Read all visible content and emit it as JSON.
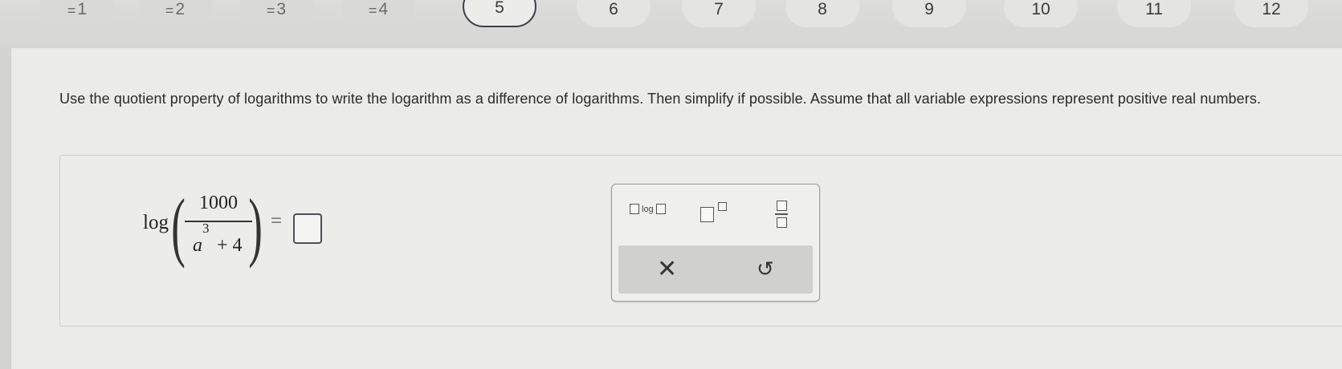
{
  "nav": {
    "items": [
      {
        "label": "1",
        "state": "done"
      },
      {
        "label": "2",
        "state": "done"
      },
      {
        "label": "3",
        "state": "done"
      },
      {
        "label": "4",
        "state": "done"
      },
      {
        "label": "5",
        "state": "current"
      },
      {
        "label": "6",
        "state": "todo"
      },
      {
        "label": "7",
        "state": "todo"
      },
      {
        "label": "8",
        "state": "todo"
      },
      {
        "label": "9",
        "state": "todo"
      },
      {
        "label": "10",
        "state": "todo"
      },
      {
        "label": "11",
        "state": "todo"
      },
      {
        "label": "12",
        "state": "todo"
      }
    ]
  },
  "question": {
    "text": "Use the quotient property of logarithms to write the logarithm as a difference of logarithms. Then simplify if possible. Assume that all variable expressions represent positive real numbers."
  },
  "expression": {
    "func": "log",
    "numerator": "1000",
    "den_var": "a",
    "den_exp": "3",
    "den_rest": "+ 4",
    "equals": "="
  },
  "palette": {
    "log_label": "log",
    "clear_symbol": "✕",
    "undo_symbol": "↺"
  }
}
